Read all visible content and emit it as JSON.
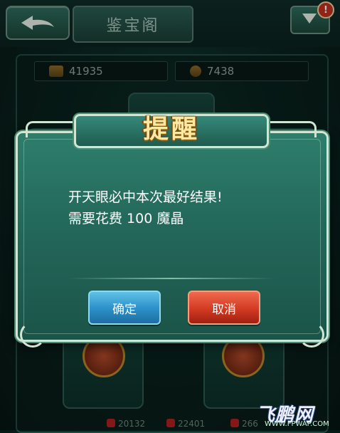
{
  "header": {
    "title": "鉴宝阁",
    "back_icon": "back-arrow-icon",
    "menu_icon": "dropdown-triangle-icon",
    "notification_badge": "!"
  },
  "currencies": [
    {
      "icon": "gold-ingot-icon",
      "value": "41935"
    },
    {
      "icon": "gold-coin-icon",
      "value": "7438"
    }
  ],
  "background_stats": [
    "20132",
    "22401",
    "266"
  ],
  "dialog": {
    "title": "提醒",
    "message": "开天眼必中本次最好结果!\n需要花费 100 魔晶",
    "confirm_label": "确定",
    "cancel_label": "取消"
  },
  "watermark": {
    "text": "飞鹏网",
    "url": "WWW.FPWAP.COM"
  },
  "colors": {
    "dialog_bg": "#23685a",
    "title_gold": "#ffe9a0",
    "confirm_blue": "#2a8fc8",
    "cancel_red": "#d23a22"
  }
}
